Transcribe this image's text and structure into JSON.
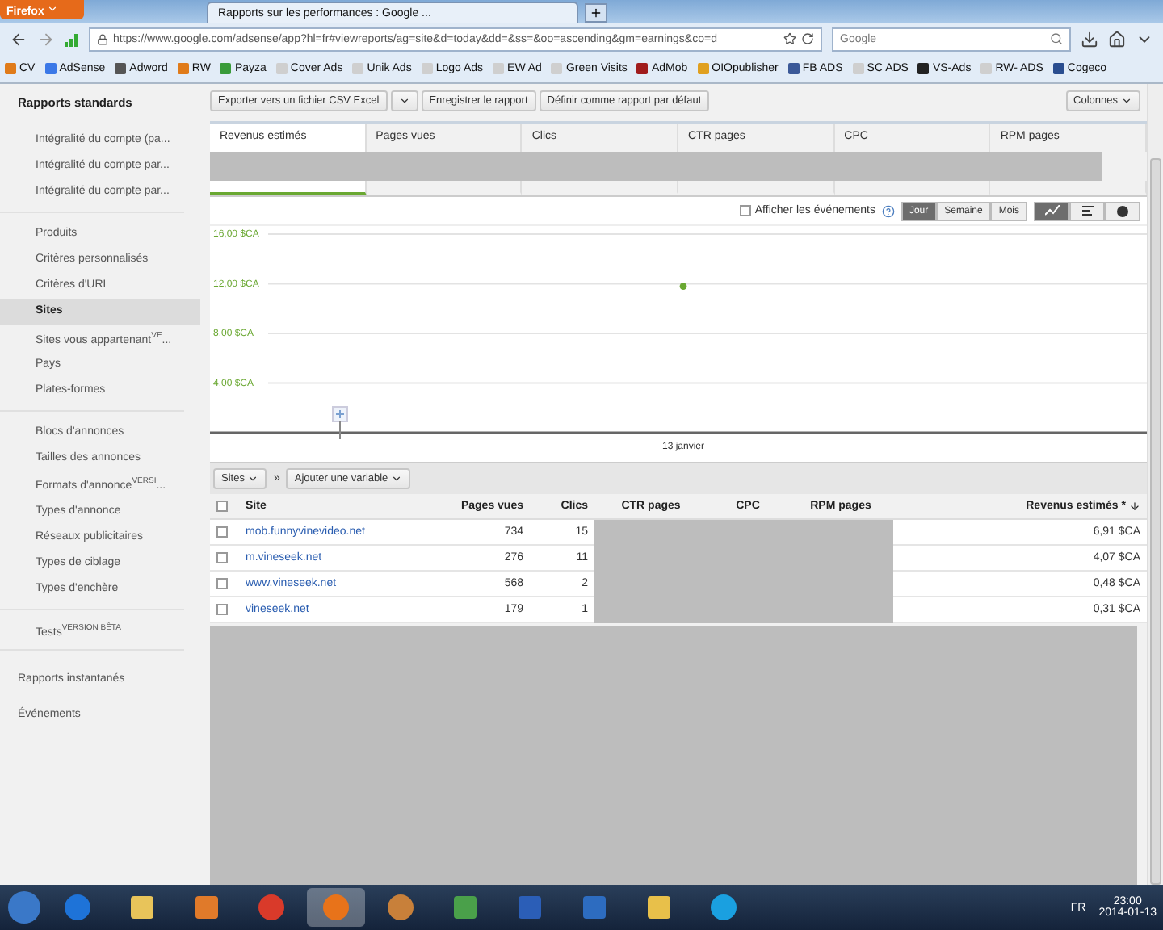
{
  "browser": {
    "menu_button": "Firefox",
    "tabs": [
      {
        "title": "Rapports sur les performances : Google ...",
        "selected": true
      }
    ],
    "url": "https://www.google.com/adsense/app?hl=fr#viewreports/ag=site&d=today&dd=&ss=&oo=ascending&gm=earnings&co=d",
    "search_placeholder": "Google",
    "bookmarks": [
      {
        "label": "CV",
        "color": "#e07b1a"
      },
      {
        "label": "AdSense",
        "color": "#3b78e7"
      },
      {
        "label": "Adword",
        "color": "#555555"
      },
      {
        "label": "RW",
        "color": "#e07b1a"
      },
      {
        "label": "Payza",
        "color": "#3a9b3a"
      },
      {
        "label": "Cover Ads",
        "color": "#cfcfcf"
      },
      {
        "label": "Unik Ads",
        "color": "#cfcfcf"
      },
      {
        "label": "Logo Ads",
        "color": "#cfcfcf"
      },
      {
        "label": "EW Ad",
        "color": "#cfcfcf"
      },
      {
        "label": "Green Visits",
        "color": "#cfcfcf"
      },
      {
        "label": "AdMob",
        "color": "#a01c1c"
      },
      {
        "label": "OIOpublisher",
        "color": "#e0a020"
      },
      {
        "label": "FB ADS",
        "color": "#3b5998"
      },
      {
        "label": "SC ADS",
        "color": "#cfcfcf"
      },
      {
        "label": "VS-Ads",
        "color": "#222222"
      },
      {
        "label": "RW- ADS",
        "color": "#cfcfcf"
      },
      {
        "label": "Cogeco",
        "color": "#2a4d8f"
      }
    ]
  },
  "sidebar": {
    "header": "Rapports standards",
    "groups": [
      [
        {
          "label": "Intégralité du compte (pa...",
          "selected": false
        },
        {
          "label": "Intégralité du compte par...",
          "selected": false
        },
        {
          "label": "Intégralité du compte par...",
          "selected": false
        }
      ],
      [
        {
          "label": "Produits",
          "selected": false
        },
        {
          "label": "Critères personnalisés",
          "selected": false
        },
        {
          "label": "Critères d'URL",
          "selected": false
        },
        {
          "label": "Sites",
          "selected": true
        },
        {
          "label": "Sites vous appartenant$^{VE}$...",
          "selected": false
        },
        {
          "label": "Pays",
          "selected": false
        },
        {
          "label": "Plates-formes",
          "selected": false
        }
      ],
      [
        {
          "label": "Blocs d'annonces",
          "selected": false
        },
        {
          "label": "Tailles des annonces",
          "selected": false
        },
        {
          "label": "Formats d'annonce$^{VERSI}$...",
          "selected": false
        },
        {
          "label": "Types d'annonce",
          "selected": false
        },
        {
          "label": "Réseaux publicitaires",
          "selected": false
        },
        {
          "label": "Types de ciblage",
          "selected": false
        },
        {
          "label": "Types d'enchère",
          "selected": false
        }
      ],
      [
        {
          "label": "Tests$^{VERSION BÊTA}$",
          "selected": false
        }
      ]
    ],
    "links": [
      "Rapports instantanés",
      "Événements"
    ]
  },
  "toolbar": {
    "buttons": [
      "Exporter vers un fichier CSV Excel",
      "Enregistrer le rapport",
      "Définir comme rapport par défaut"
    ],
    "columns_button": "Colonnes"
  },
  "metrics": [
    {
      "label": "Revenus estimés",
      "selected": true
    },
    {
      "label": "Pages vues",
      "selected": false
    },
    {
      "label": "Clics",
      "selected": false
    },
    {
      "label": "CTR pages",
      "selected": false
    },
    {
      "label": "CPC",
      "selected": false
    },
    {
      "label": "RPM pages",
      "selected": false
    }
  ],
  "events_checkbox": {
    "label": "Afficher les événements",
    "checked": false
  },
  "periods": [
    {
      "label": "Jour",
      "selected": true
    },
    {
      "label": "Semaine",
      "selected": false
    },
    {
      "label": "Mois",
      "selected": false
    }
  ],
  "chart_types": [
    {
      "kind": "line",
      "selected": true
    },
    {
      "kind": "bar",
      "selected": false
    },
    {
      "kind": "pie",
      "selected": false
    }
  ],
  "chart": {
    "chart_data": {
      "type": "line",
      "categories": [
        "13 janvier"
      ],
      "series": [
        {
          "color": "#6aa832",
          "marker": "o",
          "values": [
            11.8
          ]
        }
      ],
      "ylim": [
        0,
        16
      ],
      "grid": true,
      "yticks": [
        {
          "value": 4,
          "label": "4,00 $CA"
        },
        {
          "value": 8,
          "label": "8,00 $CA"
        },
        {
          "value": 12,
          "label": "12,00 $CA"
        },
        {
          "value": 16,
          "label": "16,00 $CA"
        }
      ]
    }
  },
  "table_toolbar": {
    "dimension": "Sites",
    "separator": "»",
    "add_variable": "Ajouter une variable"
  },
  "table": {
    "header_checked": false,
    "columns": [
      "Site",
      "Pages vues",
      "Clics",
      "CTR pages",
      "CPC",
      "RPM pages",
      "Revenus estimés *"
    ],
    "rows": [
      {
        "checked": false,
        "site": "mob.funnyvinevideo.net",
        "pages": "734",
        "clicks": "15",
        "revenue": "6,91 $CA"
      },
      {
        "checked": false,
        "site": "m.vineseek.net",
        "pages": "276",
        "clicks": "11",
        "revenue": "4,07 $CA"
      },
      {
        "checked": false,
        "site": "www.vineseek.net",
        "pages": "568",
        "clicks": "2",
        "revenue": "0,48 $CA"
      },
      {
        "checked": false,
        "site": "vineseek.net",
        "pages": "179",
        "clicks": "1",
        "revenue": "0,31 $CA"
      }
    ]
  },
  "taskbar": {
    "apps": [
      {
        "kind": "ie",
        "selected": false
      },
      {
        "kind": "folder",
        "selected": false
      },
      {
        "kind": "media",
        "selected": false
      },
      {
        "kind": "chrome",
        "selected": false
      },
      {
        "kind": "firefox",
        "selected": true
      },
      {
        "kind": "paint",
        "selected": false
      },
      {
        "kind": "tool",
        "selected": false
      },
      {
        "kind": "word",
        "selected": false
      },
      {
        "kind": "outlook",
        "selected": false
      },
      {
        "kind": "mail",
        "selected": false
      },
      {
        "kind": "skype",
        "selected": false
      }
    ],
    "language": "FR",
    "time": "23:00",
    "date": "2014-01-13"
  }
}
